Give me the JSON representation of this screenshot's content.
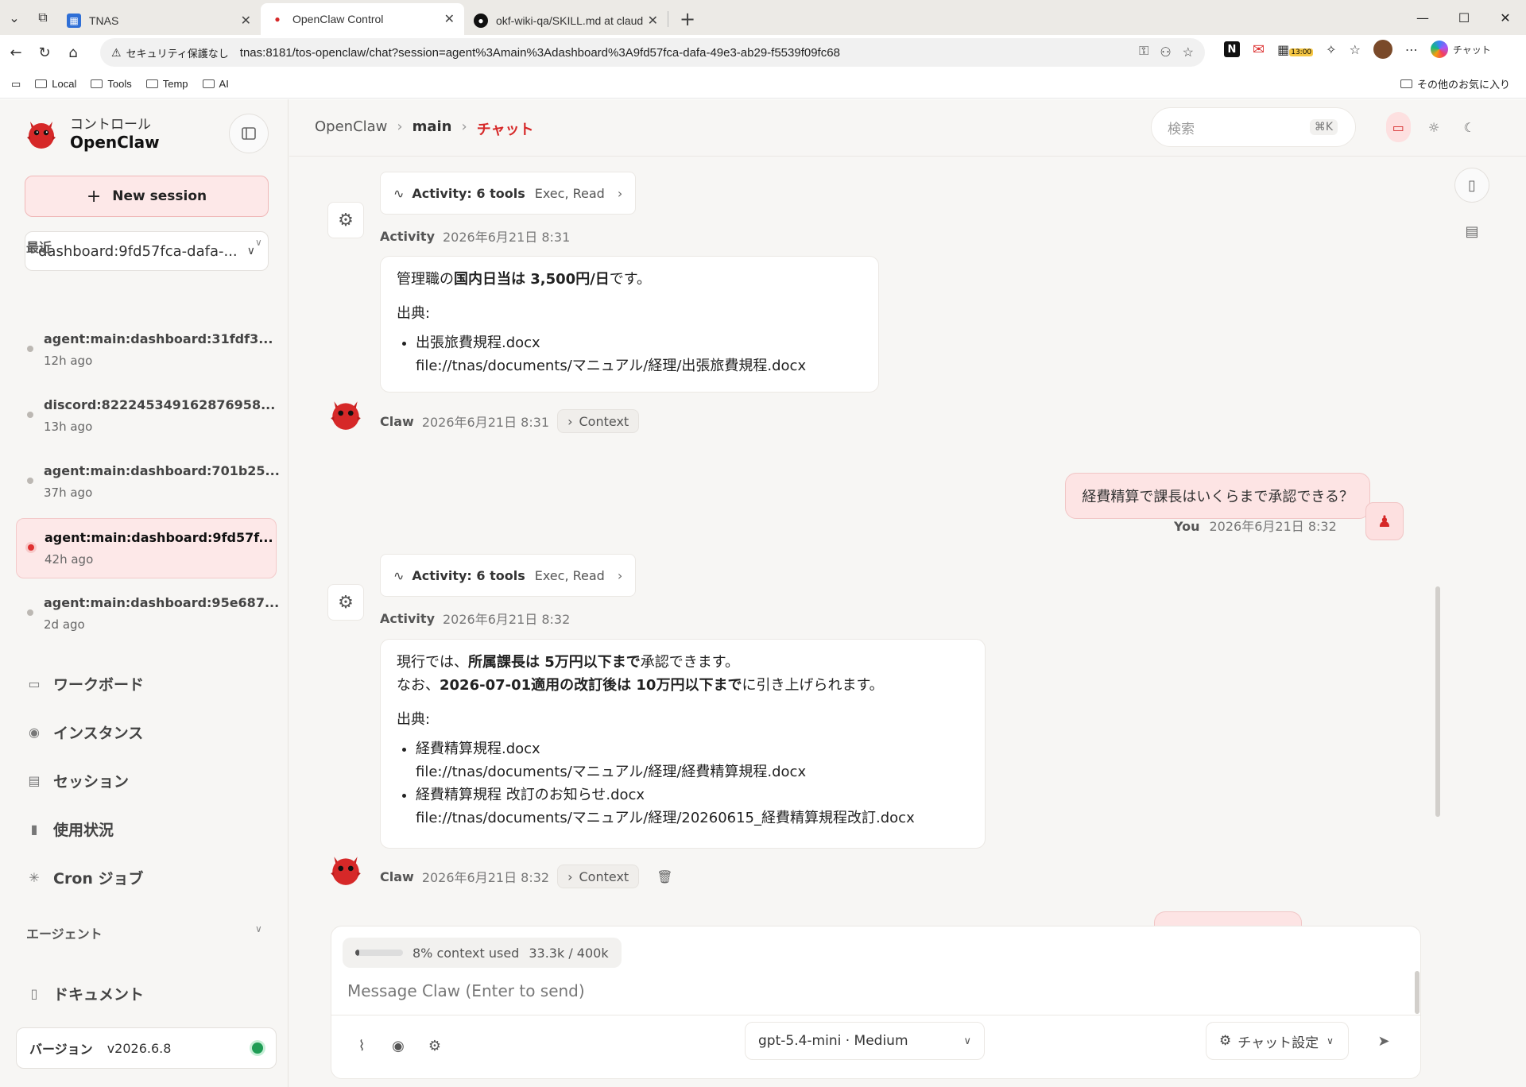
{
  "browser": {
    "tabs": [
      {
        "title": "TNAS",
        "icon": "tnas-icon"
      },
      {
        "title": "OpenClaw Control",
        "icon": "openclaw-icon"
      },
      {
        "title": "okf-wiki-qa/SKILL.md at claude/jol",
        "icon": "github-icon"
      }
    ],
    "security_label": "セキュリティ保護なし",
    "url": "tnas:8181/tos-openclaw/chat?session=agent%3Amain%3Adashboard%3A9fd57fca-dafa-49e3-ab29-f5539f09fc68",
    "ext_badge": "13:00",
    "copilot_label": "チャット",
    "bookmarks": [
      "Local",
      "Tools",
      "Temp",
      "AI"
    ],
    "bookmarks_other": "その他のお気に入り"
  },
  "sidebar": {
    "brand_sub": "コントロール",
    "brand_title": "OpenClaw",
    "new_session": "New session",
    "session_select": "dashboard:9fd57fca-dafa-...",
    "recent_heading": "最近",
    "recent": [
      {
        "title": "agent:main:dashboard:31fdf3...",
        "time": "12h ago"
      },
      {
        "title": "discord:822245349162876958...",
        "time": "13h ago"
      },
      {
        "title": "agent:main:dashboard:701b25...",
        "time": "37h ago"
      },
      {
        "title": "agent:main:dashboard:9fd57f...",
        "time": "42h ago"
      },
      {
        "title": "agent:main:dashboard:95e687...",
        "time": "2d ago"
      }
    ],
    "nav": [
      "ワークボード",
      "インスタンス",
      "セッション",
      "使用状況",
      "Cron ジョブ"
    ],
    "agents_heading": "エージェント",
    "docs": "ドキュメント",
    "version_label": "バージョン",
    "version": "v2026.6.8"
  },
  "header": {
    "crumbs": [
      "OpenClaw",
      "main",
      "チャット"
    ],
    "search_placeholder": "検索",
    "search_kbd": "⌘K"
  },
  "chat": {
    "activity1": {
      "label": "Activity: 6 tools",
      "tools": "Exec, Read",
      "who": "Activity",
      "time": "2026年6月21日 8:31"
    },
    "reply1": {
      "pre": "管理職の",
      "bold": "国内日当は 3,500円/日",
      "post": "です。",
      "source_label": "出典:",
      "sources": [
        {
          "name": "出張旅費規程.docx",
          "path": "file://tnas/documents/マニュアル/経理/出張旅費規程.docx"
        }
      ],
      "who": "Claw",
      "time": "2026年6月21日 8:31",
      "context": "Context"
    },
    "user1": {
      "text": "経費精算で課長はいくらまで承認できる？",
      "who": "You",
      "time": "2026年6月21日 8:32"
    },
    "activity2": {
      "label": "Activity: 6 tools",
      "tools": "Exec, Read",
      "who": "Activity",
      "time": "2026年6月21日 8:32"
    },
    "reply2": {
      "l1_pre": "現行では、",
      "l1_bold": "所属課長は 5万円以下まで",
      "l1_post": "承認できます。",
      "l2_pre": "なお、",
      "l2_bold": "2026-07-01適用の改訂後は 10万円以下まで",
      "l2_post": "に引き上げられます。",
      "source_label": "出典:",
      "sources": [
        {
          "name": "経費精算規程.docx",
          "path": "file://tnas/documents/マニュアル/経理/経費精算規程.docx"
        },
        {
          "name": "経費精算規程 改訂のお知らせ.docx",
          "path": "file://tnas/documents/マニュアル/経理/20260615_経費精算規程改訂.docx"
        }
      ],
      "who": "Claw",
      "time": "2026年6月21日 8:32",
      "context": "Context"
    }
  },
  "composer": {
    "context_used": "8% context used",
    "context_tokens": "33.3k / 400k",
    "context_fraction": 0.083,
    "placeholder": "Message Claw (Enter to send)",
    "model": "gpt-5.4-mini · Medium",
    "chat_settings": "チャット設定"
  },
  "colors": {
    "accent": "#d62828",
    "accent_soft": "#fde8e8",
    "status_ok": "#1f9d55"
  }
}
